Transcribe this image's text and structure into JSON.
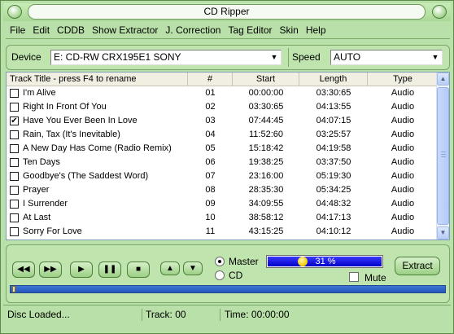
{
  "window": {
    "title": "CD Ripper"
  },
  "menu": [
    "File",
    "Edit",
    "CDDB",
    "Show Extractor",
    "J. Correction",
    "Tag Editor",
    "Skin",
    "Help"
  ],
  "device": {
    "device_label": "Device",
    "device_value": "E: CD-RW  CRX195E1  SONY",
    "speed_label": "Speed",
    "speed_value": "AUTO"
  },
  "table": {
    "columns": [
      "Track Title - press F4 to rename",
      "#",
      "Start",
      "Length",
      "Type"
    ],
    "rows": [
      {
        "checked": false,
        "title": "I'm Alive",
        "num": "01",
        "start": "00:00:00",
        "length": "03:30:65",
        "type": "Audio"
      },
      {
        "checked": false,
        "title": "Right In Front Of You",
        "num": "02",
        "start": "03:30:65",
        "length": "04:13:55",
        "type": "Audio"
      },
      {
        "checked": true,
        "title": "Have You Ever Been In Love",
        "num": "03",
        "start": "07:44:45",
        "length": "04:07:15",
        "type": "Audio"
      },
      {
        "checked": false,
        "title": "Rain, Tax (It's Inevitable)",
        "num": "04",
        "start": "11:52:60",
        "length": "03:25:57",
        "type": "Audio"
      },
      {
        "checked": false,
        "title": "A New Day Has Come (Radio Remix)",
        "num": "05",
        "start": "15:18:42",
        "length": "04:19:58",
        "type": "Audio"
      },
      {
        "checked": false,
        "title": "Ten Days",
        "num": "06",
        "start": "19:38:25",
        "length": "03:37:50",
        "type": "Audio"
      },
      {
        "checked": false,
        "title": "Goodbye's (The Saddest Word)",
        "num": "07",
        "start": "23:16:00",
        "length": "05:19:30",
        "type": "Audio"
      },
      {
        "checked": false,
        "title": "Prayer",
        "num": "08",
        "start": "28:35:30",
        "length": "05:34:25",
        "type": "Audio"
      },
      {
        "checked": false,
        "title": "I Surrender",
        "num": "09",
        "start": "34:09:55",
        "length": "04:48:32",
        "type": "Audio"
      },
      {
        "checked": false,
        "title": "At Last",
        "num": "10",
        "start": "38:58:12",
        "length": "04:17:13",
        "type": "Audio"
      },
      {
        "checked": false,
        "title": "Sorry For Love",
        "num": "11",
        "start": "43:15:25",
        "length": "04:10:12",
        "type": "Audio"
      }
    ]
  },
  "controls": {
    "source_master": "Master",
    "source_cd": "CD",
    "source_selected": "Master",
    "volume_text": "31 %",
    "volume_fraction": 0.31,
    "mute_label": "Mute",
    "mute_checked": false,
    "extract_label": "Extract",
    "progress_fraction": 0.0
  },
  "status": {
    "message": "Disc Loaded...",
    "track": "Track: 00",
    "time": "Time: 00:00:00"
  },
  "colors": {
    "skin_green": "#b8e0a8",
    "volume_blue": "#0000c8",
    "progress_blue": "#2455b8"
  }
}
